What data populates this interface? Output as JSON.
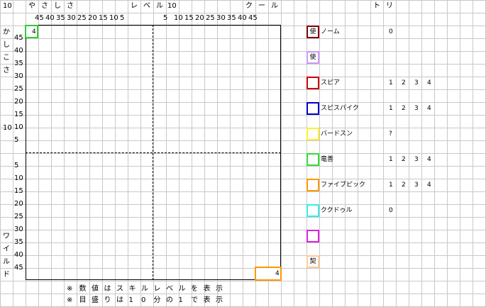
{
  "header": {
    "top_left_level": "10",
    "yasashisa": [
      "や",
      "さ",
      "し",
      "さ"
    ],
    "level_label": [
      "レ",
      "ベ",
      "ル"
    ],
    "level_value": "10",
    "cool": [
      "ク",
      "ー",
      "ル"
    ],
    "tori": [
      "ト",
      "リ"
    ]
  },
  "x_ticks_left": [
    "45",
    "40",
    "35",
    "30",
    "25",
    "20",
    "15",
    "10",
    "5"
  ],
  "x_ticks_right": [
    "5",
    "10",
    "15",
    "20",
    "25",
    "30",
    "35",
    "40",
    "45"
  ],
  "y_ticks_top": [
    "45",
    "40",
    "35",
    "30",
    "25",
    "20",
    "15",
    "10",
    "5"
  ],
  "y_ticks_bottom": [
    "5",
    "10",
    "15",
    "20",
    "25",
    "30",
    "35",
    "40",
    "45"
  ],
  "left_label_top": [
    "か",
    "し",
    "こ",
    "さ"
  ],
  "left_label_top_level": "10",
  "left_label_bottom": [
    "ワ",
    "イ",
    "ル",
    "ド"
  ],
  "markers": [
    {
      "value": "4",
      "color": "#33cc33"
    },
    {
      "value": "4",
      "color": "#ff9900"
    }
  ],
  "legend": [
    {
      "box_text": "使",
      "color": "#800000",
      "label": "ノーム",
      "tori": [
        "0"
      ]
    },
    {
      "box_text": "使",
      "color": "#cc99ff",
      "label": "",
      "tori": []
    },
    {
      "box_text": "",
      "color": "#cc0000",
      "label": "スピア",
      "tori": [
        "1",
        "2",
        "3",
        "4"
      ]
    },
    {
      "box_text": "",
      "color": "#0000cc",
      "label": "スピスパイク",
      "tori": [
        "1",
        "2",
        "3",
        "4"
      ]
    },
    {
      "box_text": "",
      "color": "#ffee33",
      "label": "バードスン",
      "tori": [
        "?"
      ]
    },
    {
      "box_text": "",
      "color": "#33dd33",
      "label": "竜善",
      "tori": [
        "1",
        "2",
        "3",
        "4"
      ]
    },
    {
      "box_text": "",
      "color": "#ff9900",
      "label": "ファイブピック",
      "tori": [
        "1",
        "2",
        "3",
        "4"
      ]
    },
    {
      "box_text": "",
      "color": "#33eeee",
      "label": "ククドゥル",
      "tori": [
        "0"
      ]
    },
    {
      "box_text": "",
      "color": "#dd22dd",
      "label": "",
      "tori": []
    },
    {
      "box_text": "契",
      "color": "#ffcc99",
      "label": "",
      "tori": []
    }
  ],
  "notes": [
    [
      "※",
      "数",
      "値",
      "は",
      "ス",
      "キ",
      "ル",
      "レ",
      "ベ",
      "ル",
      "を",
      "表",
      "示"
    ],
    [
      "※",
      "目",
      "盛",
      "り",
      "は",
      "1",
      "0",
      "分",
      "の",
      "1",
      "で",
      "表",
      "示"
    ]
  ]
}
